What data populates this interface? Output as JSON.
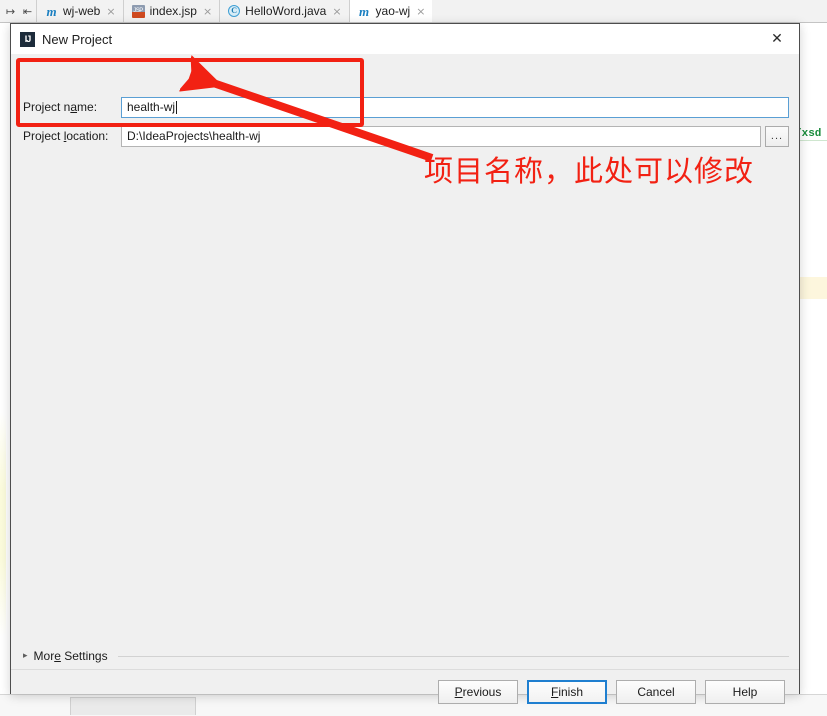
{
  "ide": {
    "gutter_icons": [
      "collapse-all-icon",
      "expand-select-icon"
    ],
    "tabs": [
      {
        "label": "wj-web",
        "icon": "maven-module-icon",
        "active": false,
        "close": "×"
      },
      {
        "label": "index.jsp",
        "icon": "jsp-file-icon",
        "active": false,
        "close": "×"
      },
      {
        "label": "HelloWord.java",
        "icon": "java-class-icon",
        "active": false,
        "close": "×"
      },
      {
        "label": "yao-wj",
        "icon": "maven-module-icon",
        "active": true,
        "close": "×"
      }
    ],
    "editor_code_fragment": "/xsd"
  },
  "dialog": {
    "title": "New Project",
    "icon": "intellij-idea-icon",
    "close_label": "✕",
    "fields": {
      "project_name": {
        "label_pre": "Project n",
        "label_mnemonic": "a",
        "label_post": "me:",
        "value": "health-wj",
        "placeholder": ""
      },
      "project_location": {
        "label_pre": "Project ",
        "label_mnemonic": "l",
        "label_post": "ocation:",
        "value": "D:\\IdeaProjects\\health-wj",
        "placeholder": "",
        "browse_label": "..."
      }
    },
    "more_settings": {
      "arrow": "▸",
      "label_pre": "Mor",
      "label_mnemonic": "e",
      "label_post": " Settings"
    },
    "buttons": [
      {
        "name": "previous",
        "pre": "",
        "mnemonic": "P",
        "post": "revious",
        "default": false
      },
      {
        "name": "finish",
        "pre": "",
        "mnemonic": "F",
        "post": "inish",
        "default": true
      },
      {
        "name": "cancel",
        "pre": "Cancel",
        "mnemonic": "",
        "post": "",
        "default": false
      },
      {
        "name": "help",
        "pre": "Help",
        "mnemonic": "",
        "post": "",
        "default": false
      }
    ]
  },
  "annotation": {
    "text": "项目名称，此处可以修改",
    "color": "#f22113",
    "box_target": "project-name-and-location-fields",
    "arrow_points_to": "project-name-input"
  }
}
